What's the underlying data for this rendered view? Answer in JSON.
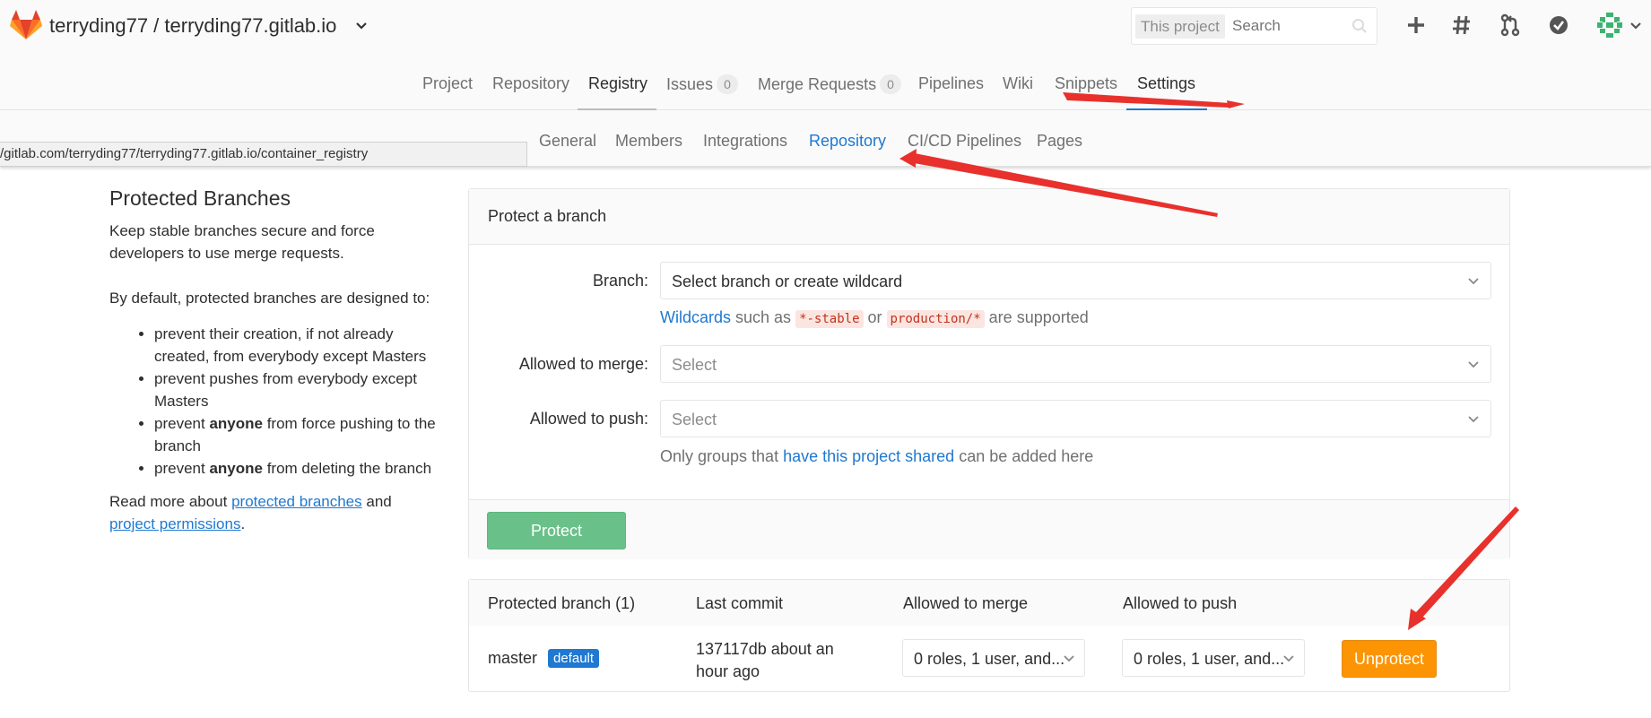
{
  "header": {
    "project_title": "terryding77 / terryding77.gitlab.io",
    "search_scope": "This project",
    "search_placeholder": "Search"
  },
  "main_tabs": [
    {
      "label": "Project"
    },
    {
      "label": "Repository"
    },
    {
      "label": "Registry"
    },
    {
      "label": "Issues",
      "count": "0"
    },
    {
      "label": "Merge Requests",
      "count": "0"
    },
    {
      "label": "Pipelines"
    },
    {
      "label": "Wiki"
    },
    {
      "label": "Snippets"
    },
    {
      "label": "Settings"
    }
  ],
  "sub_tabs": [
    {
      "label": "General"
    },
    {
      "label": "Members"
    },
    {
      "label": "Integrations"
    },
    {
      "label": "Repository"
    },
    {
      "label": "CI/CD Pipelines"
    },
    {
      "label": "Pages"
    }
  ],
  "status_url": "/gitlab.com/terryding77/terryding77.gitlab.io/container_registry",
  "left": {
    "title": "Protected Branches",
    "intro": "Keep stable branches secure and force developers to use merge requests.",
    "default_text": "By default, protected branches are designed to:",
    "bullets": [
      {
        "pre": "prevent their creation, if not already created, from everybody except Masters"
      },
      {
        "pre": "prevent pushes from everybody except Masters"
      },
      {
        "pre": "prevent ",
        "bold": "anyone",
        "post": " from force pushing to the branch"
      },
      {
        "pre": "prevent ",
        "bold": "anyone",
        "post": " from deleting the branch"
      }
    ],
    "read_more_pre": "Read more about ",
    "read_more_link1": "protected branches",
    "read_more_mid": " and",
    "read_more_link2": "project permissions",
    "read_more_post": "."
  },
  "protect_form": {
    "title": "Protect a branch",
    "branch_label": "Branch:",
    "branch_placeholder": "Select branch or create wildcard",
    "wildcards_link": "Wildcards",
    "wildcards_text1": " such as ",
    "wildcard_example1": "*-stable",
    "wildcards_text2": " or ",
    "wildcard_example2": "production/*",
    "wildcards_text3": " are supported",
    "merge_label": "Allowed to merge:",
    "merge_placeholder": "Select",
    "push_label": "Allowed to push:",
    "push_placeholder": "Select",
    "groups_text1": "Only groups that ",
    "groups_link": "have this project shared",
    "groups_text2": " can be added here",
    "protect_button": "Protect"
  },
  "branches_table": {
    "headers": [
      "Protected branch (1)",
      "Last commit",
      "Allowed to merge",
      "Allowed to push"
    ],
    "row": {
      "branch": "master",
      "badge": "default",
      "commit_line1": "137117db about an",
      "commit_line2": "hour ago",
      "merge_roles": "0 roles, 1 user, and...",
      "push_roles": "0 roles, 1 user, and...",
      "unprotect_button": "Unprotect"
    }
  },
  "colors": {
    "link_blue": "#1f78d1",
    "protect_green": "#69c189",
    "unprotect_orange": "#fc9403",
    "annotation_red": "#e8312c"
  }
}
